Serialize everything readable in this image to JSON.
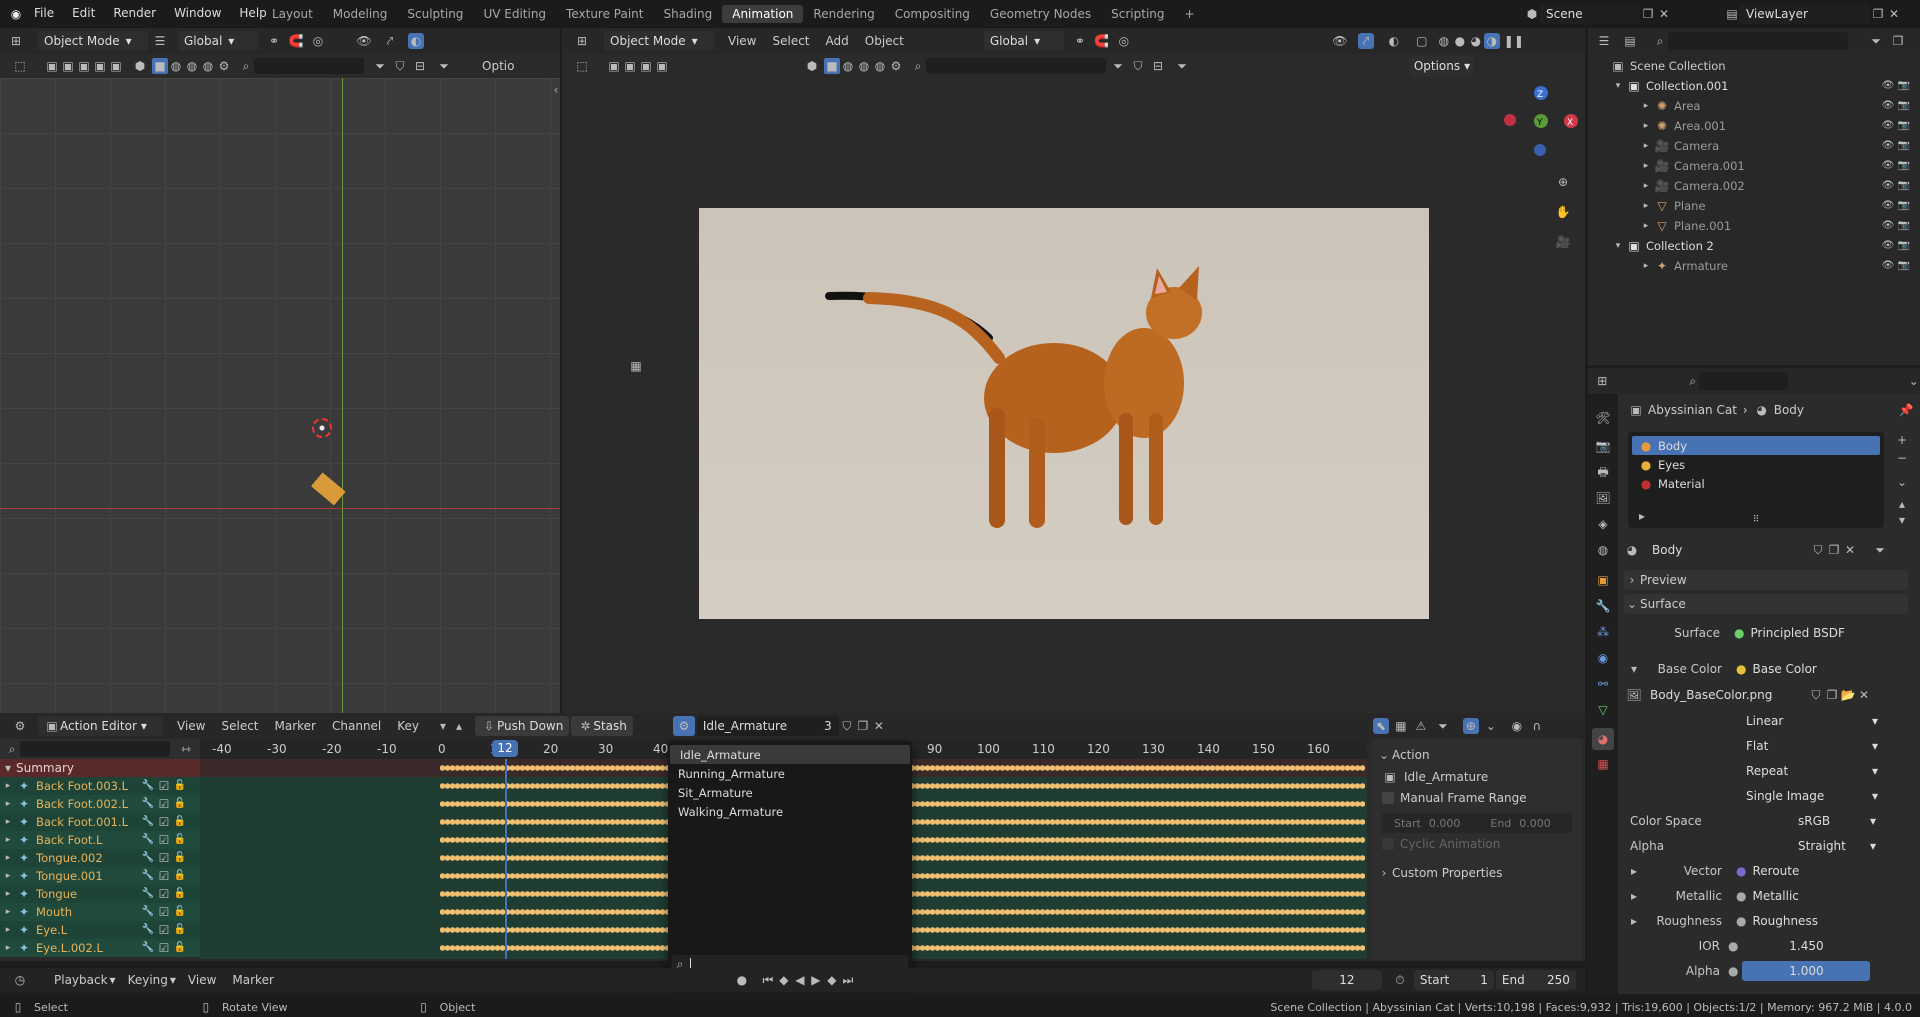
{
  "topbar": {
    "menus": [
      "File",
      "Edit",
      "Render",
      "Window",
      "Help"
    ],
    "workspaces": [
      "Layout",
      "Modeling",
      "Sculpting",
      "UV Editing",
      "Texture Paint",
      "Shading",
      "Animation",
      "Rendering",
      "Compositing",
      "Geometry Nodes",
      "Scripting"
    ],
    "active_workspace": "Animation",
    "scene": "Scene",
    "viewlayer": "ViewLayer"
  },
  "left_view": {
    "mode": "Object Mode",
    "orientation": "Global",
    "options_label": "Optio"
  },
  "main_view": {
    "mode": "Object Mode",
    "menus": [
      "View",
      "Select",
      "Add",
      "Object"
    ],
    "orientation": "Global",
    "options_label": "Options"
  },
  "gizmo": {
    "x": "X",
    "y": "Y",
    "z": "Z"
  },
  "outliner": {
    "root": "Scene Collection",
    "items": [
      {
        "name": "Collection.001",
        "level": 0,
        "type": "collection"
      },
      {
        "name": "Area",
        "level": 1,
        "type": "light"
      },
      {
        "name": "Area.001",
        "level": 1,
        "type": "light"
      },
      {
        "name": "Camera",
        "level": 1,
        "type": "camera"
      },
      {
        "name": "Camera.001",
        "level": 1,
        "type": "camera"
      },
      {
        "name": "Camera.002",
        "level": 1,
        "type": "camera"
      },
      {
        "name": "Plane",
        "level": 1,
        "type": "mesh"
      },
      {
        "name": "Plane.001",
        "level": 1,
        "type": "mesh"
      },
      {
        "name": "Collection 2",
        "level": 0,
        "type": "collection"
      },
      {
        "name": "Armature",
        "level": 1,
        "type": "armature"
      }
    ]
  },
  "properties": {
    "breadcrumb_object": "Abyssinian Cat",
    "breadcrumb_material": "Body",
    "materials": [
      "Body",
      "Eyes",
      "Material"
    ],
    "material_name": "Body",
    "preview": "Preview",
    "surface": "Surface",
    "surface_label": "Surface",
    "surface_value": "Principled BSDF",
    "base_color_label": "Base Color",
    "base_color_value": "Base Color",
    "image_name": "Body_BaseColor.png",
    "interpolation": "Linear",
    "projection": "Flat",
    "extension": "Repeat",
    "source": "Single Image",
    "color_space_label": "Color Space",
    "color_space": "sRGB",
    "alpha_label": "Alpha",
    "alpha_mode": "Straight",
    "vector_label": "Vector",
    "vector_value": "Reroute",
    "metallic_label": "Metallic",
    "metallic_value": "Metallic",
    "roughness_label": "Roughness",
    "roughness_value": "Roughness",
    "ior_label": "IOR",
    "ior_value": "1.450",
    "alpha2_label": "Alpha",
    "alpha2_value": "1.000"
  },
  "action_editor": {
    "editor": "Action Editor",
    "menus": [
      "View",
      "Select",
      "Marker",
      "Channel",
      "Key"
    ],
    "push_down": "Push Down",
    "stash": "Stash",
    "action": "Idle_Armature",
    "users": "3",
    "summary": "Summary",
    "channels": [
      "Back Foot.003.L",
      "Back Foot.002.L",
      "Back Foot.001.L",
      "Back Foot.L",
      "Tongue.002",
      "Tongue.001",
      "Tongue",
      "Mouth",
      "Eye.L",
      "Eye.L.002.L"
    ],
    "ruler": [
      "-40",
      "-30",
      "-20",
      "-10",
      "0",
      "10",
      "20",
      "30",
      "40",
      "90",
      "100",
      "110",
      "120",
      "130",
      "140",
      "150",
      "160"
    ],
    "current_frame": "12"
  },
  "action_dropdown": {
    "items": [
      "Idle_Armature",
      "Running_Armature",
      "Sit_Armature",
      "Walking_Armature"
    ]
  },
  "action_panel": {
    "header": "Action",
    "name": "Idle_Armature",
    "manual_range": "Manual Frame Range",
    "start_label": "Start",
    "start_value": "0.000",
    "end_label": "End",
    "end_value": "0.000",
    "cyclic": "Cyclic Animation",
    "custom": "Custom Properties"
  },
  "timeline": {
    "menus": [
      "Playback",
      "Keying",
      "View",
      "Marker"
    ],
    "frame": "12",
    "start_label": "Start",
    "start": "1",
    "end_label": "End",
    "end": "250"
  },
  "status": {
    "select": "Select",
    "rotate": "Rotate View",
    "object": "Object",
    "info": "Scene Collection | Abyssinian Cat | Verts:10,198 | Faces:9,932 | Tris:19,600 | Objects:1/2 | Memory: 967.2 MiB | 4.0.0"
  }
}
